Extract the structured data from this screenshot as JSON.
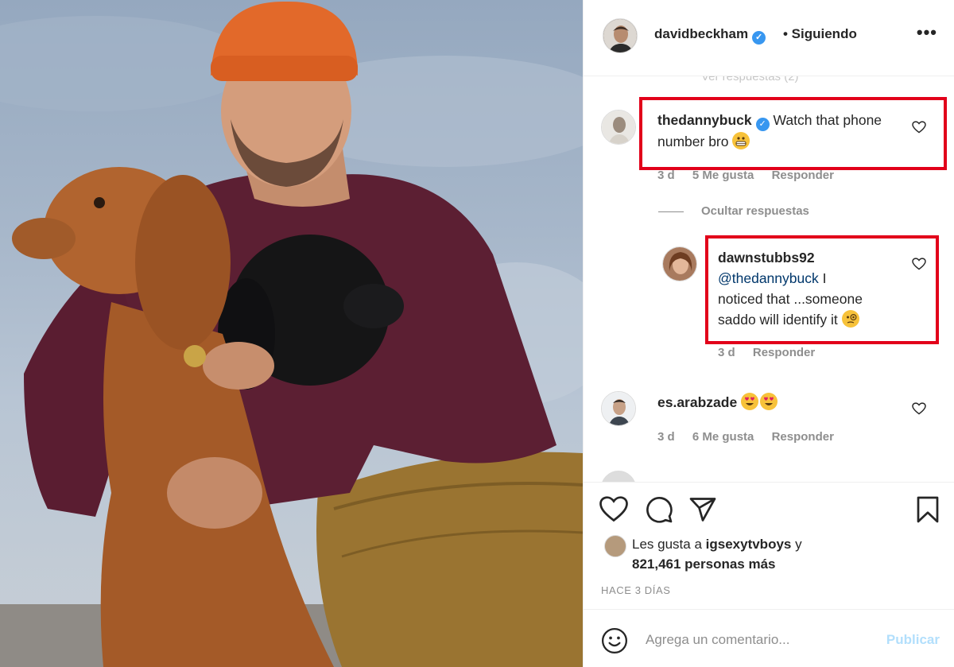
{
  "header": {
    "username": "davidbeckham",
    "separator_follow": "• Siguiendo",
    "more": "•••"
  },
  "comments": {
    "faded_top": "Ver respuestas (2)",
    "items": [
      {
        "username": "thedannybuck",
        "text": "Watch that phone number bro",
        "emoji": "grimacing-face",
        "age": "3 d",
        "likes": "5 Me gusta",
        "reply": "Responder"
      },
      {
        "username": "dawnstubbs92",
        "mention": "@thedannybuck",
        "text_line1": "I",
        "text_line2": "noticed that ...someone",
        "text_line3": "saddo will identify it",
        "emoji": "monocle-face",
        "age": "3 d",
        "reply": "Responder"
      },
      {
        "username": "es.arabzade",
        "emoji": "heart-eyes-x2",
        "age": "3 d",
        "likes": "6 Me gusta",
        "reply": "Responder"
      }
    ],
    "hide_replies": "Ocultar respuestas"
  },
  "actions": {
    "likes_prefix": "Les gusta a",
    "likes_user": "igsexytvboys",
    "likes_and": "y",
    "likes_count": "821,461 personas más",
    "time": "HACE 3 DÍAS"
  },
  "add_comment": {
    "placeholder": "Agrega un comentario...",
    "publish": "Publicar"
  },
  "colors": {
    "highlight_box": "#e2001a",
    "verified": "#3897f0",
    "publish_disabled": "#b2dffc",
    "meta_gray": "#8e8e8e"
  }
}
